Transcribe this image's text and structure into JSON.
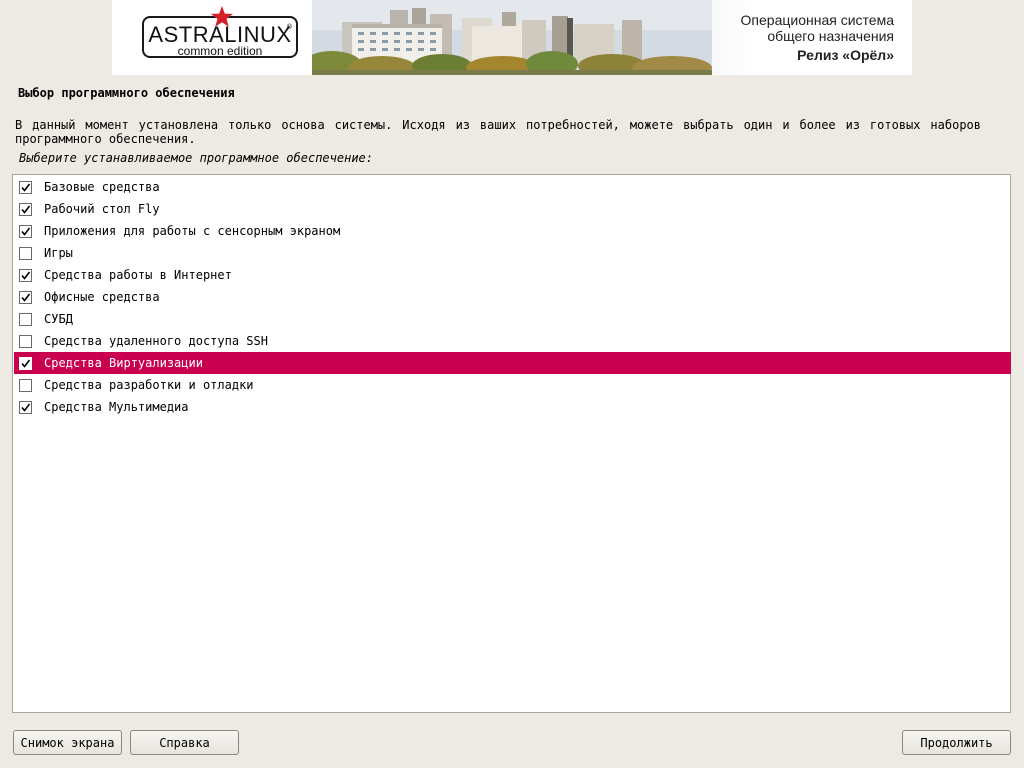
{
  "banner": {
    "logo_main": "ASTRALINUX",
    "logo_reg": "®",
    "logo_sub": "common edition",
    "line1": "Операционная система",
    "line2": "общего назначения",
    "release": "Релиз «Орёл»",
    "star_color": "#d4202b"
  },
  "page": {
    "title": "Выбор программного обеспечения",
    "description": "В данный момент установлена только основа системы. Исходя из ваших потребностей, можете выбрать один и более из готовых наборов программного обеспечения.",
    "prompt": "Выберите устанавливаемое программное обеспечение:"
  },
  "software": [
    {
      "label": "Базовые средства",
      "checked": true,
      "selected": false
    },
    {
      "label": "Рабочий стол Fly",
      "checked": true,
      "selected": false
    },
    {
      "label": "Приложения для работы с сенсорным экраном",
      "checked": true,
      "selected": false
    },
    {
      "label": "Игры",
      "checked": false,
      "selected": false
    },
    {
      "label": "Средства работы в Интернет",
      "checked": true,
      "selected": false
    },
    {
      "label": "Офисные средства",
      "checked": true,
      "selected": false
    },
    {
      "label": "СУБД",
      "checked": false,
      "selected": false
    },
    {
      "label": "Средства удаленного доступа SSH",
      "checked": false,
      "selected": false
    },
    {
      "label": "Средства Виртуализации",
      "checked": true,
      "selected": true
    },
    {
      "label": "Средства разработки и отладки",
      "checked": false,
      "selected": false
    },
    {
      "label": "Средства Мультимедиа",
      "checked": true,
      "selected": false
    }
  ],
  "buttons": {
    "screenshot": "Снимок экрана",
    "help": "Справка",
    "continue": "Продолжить"
  },
  "colors": {
    "selection": "#c8004e",
    "background": "#edeae3"
  }
}
